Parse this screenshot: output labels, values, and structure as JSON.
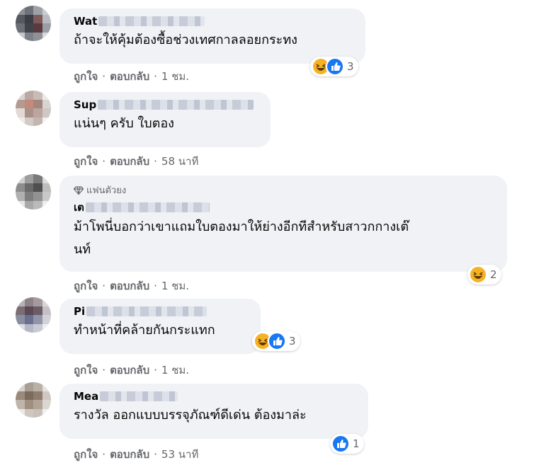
{
  "comments": [
    {
      "name_visible": "Wat",
      "text": "ถ้าจะให้คุ้มต้องซื้อช่วงเทศกาลลอยกระทง",
      "actions": {
        "like": "ถูกใจ",
        "reply": "ตอบกลับ",
        "time": "1 ชม."
      },
      "reactions": {
        "icons": [
          "haha-icon",
          "like-icon"
        ],
        "count": "3"
      }
    },
    {
      "name_visible": "Sup",
      "text": "แน่นๆ ครับ ใบตอง",
      "actions": {
        "like": "ถูกใจ",
        "reply": "ตอบกลับ",
        "time": "58 นาที"
      }
    },
    {
      "badge": "แฟนตัวยง",
      "name_visible": "เต",
      "text_line1": "ม้าโพนี่บอกว่าเขาแถมใบตองมาให้ย่างอีกทีสำหรับสาวกกางเต๊",
      "text_line2": "นท์",
      "actions": {
        "like": "ถูกใจ",
        "reply": "ตอบกลับ",
        "time": "1 ชม."
      },
      "reactions": {
        "icons": [
          "haha-icon"
        ],
        "count": "2"
      }
    },
    {
      "name_visible": "Pi",
      "text": "ทำหน้าที่คล้ายกันกระแทก",
      "actions": {
        "like": "ถูกใจ",
        "reply": "ตอบกลับ",
        "time": "1 ชม."
      },
      "reactions": {
        "icons": [
          "haha-icon",
          "like-icon"
        ],
        "count": "3"
      }
    },
    {
      "name_visible": "Mea",
      "text": "รางวัล ออกแบบบรรจุภัณฑ์ดีเด่น ต้องมาล่ะ",
      "actions": {
        "like": "ถูกใจ",
        "reply": "ตอบกลับ",
        "time": "53 นาที"
      },
      "reactions": {
        "icons": [
          "like-icon"
        ],
        "count": "1"
      }
    }
  ],
  "separator": "·",
  "colors": {
    "bubble": "#f0f2f5",
    "meta": "#65676b",
    "like": "#1877f2",
    "haha": "#f7b125"
  }
}
